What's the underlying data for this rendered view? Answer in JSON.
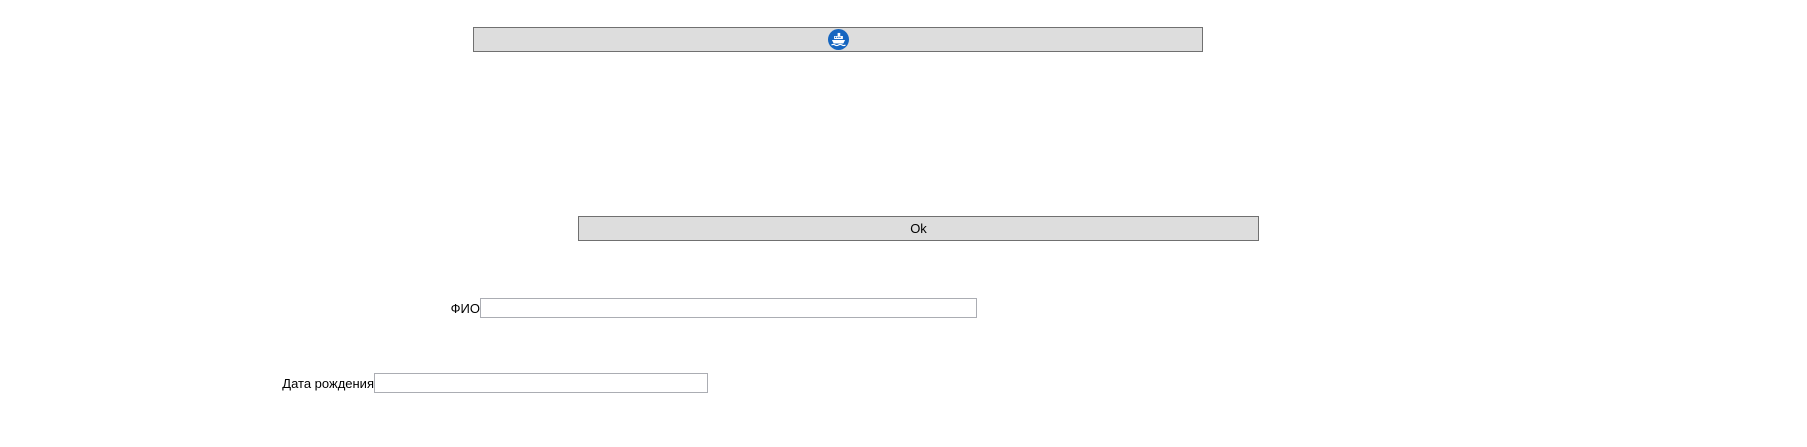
{
  "toolbar": {
    "icon_button": {
      "icon": "ship-icon",
      "icon_color": "#1565c0"
    }
  },
  "form": {
    "ok_label": "Ok",
    "fio": {
      "label": "ФИО",
      "value": "",
      "placeholder": ""
    },
    "birth_date": {
      "label": "Дата рождения",
      "value": "",
      "placeholder": ""
    }
  },
  "colors": {
    "button_background": "#dddddd",
    "button_border": "#707070",
    "input_border": "#abadb3"
  }
}
